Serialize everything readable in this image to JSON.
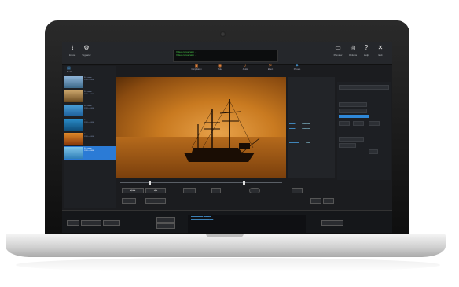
{
  "toolbar": {
    "left": [
      {
        "icon": "download-icon",
        "label": "Import"
      },
      {
        "icon": "gear-icon",
        "label": "Signatur"
      }
    ],
    "right": [
      {
        "icon": "monitor-icon",
        "label": "Preview"
      },
      {
        "icon": "globe-icon",
        "label": "Options"
      },
      {
        "icon": "help-icon",
        "label": "Help"
      },
      {
        "icon": "close-icon",
        "label": "Exit"
      }
    ],
    "status_lines": [
      "Video conversion ...",
      "Video conversion ..."
    ]
  },
  "tabs": [
    {
      "icon": "film-icon",
      "label": "Compilation"
    },
    {
      "icon": "disc-icon",
      "label": "Video"
    },
    {
      "icon": "music-icon",
      "label": "Audio"
    },
    {
      "icon": "scissors-icon",
      "label": "Effect"
    },
    {
      "icon": "wand-icon",
      "label": "Presets"
    }
  ],
  "library": {
    "label": "Media"
  },
  "files": [
    {
      "name": "File name",
      "meta": "1920 x 1080"
    },
    {
      "name": "File name",
      "meta": "1920 x 1080"
    },
    {
      "name": "File name",
      "meta": "1920 x 1080"
    },
    {
      "name": "File name",
      "meta": "1920 x 1080"
    },
    {
      "name": "File name",
      "meta": "1920 x 1080"
    },
    {
      "name": "File name",
      "meta": "1920 x 1080"
    }
  ],
  "colors": {
    "accent": "#2b7bd6",
    "status_green": "#4cd04c"
  }
}
